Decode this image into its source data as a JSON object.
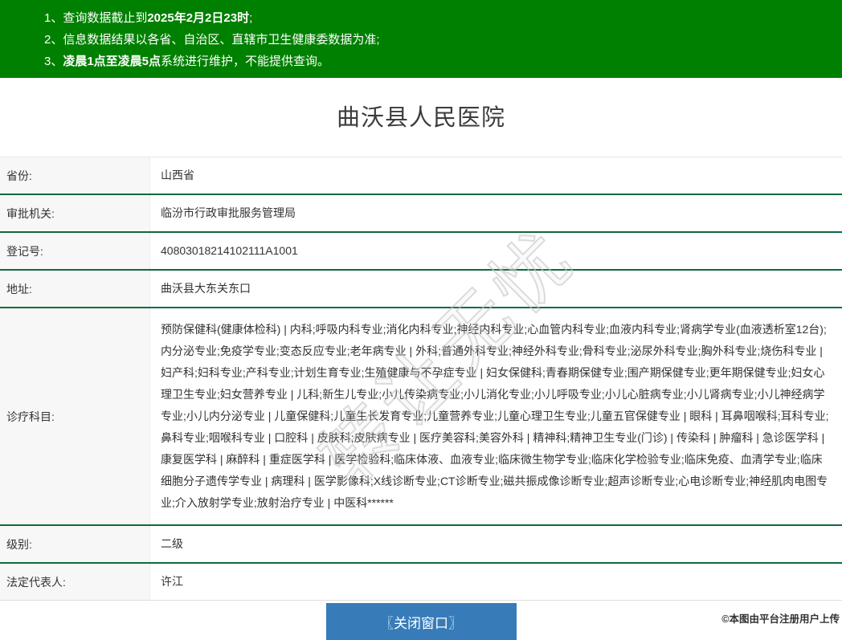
{
  "notice_bar": {
    "items": [
      {
        "prefix": "1、查询数据截止到",
        "bold": "2025年2月2日23时",
        "suffix": ";"
      },
      {
        "prefix": "2、信息数据结果以各省、自治区、直辖市卫生健康委数据为准;",
        "bold": "",
        "suffix": ""
      },
      {
        "prefix": "3、",
        "bold": "凌晨1点至凌晨5点",
        "suffix": "系统进行维护，不能提供查询。"
      }
    ]
  },
  "page": {
    "title": "曲沃县人民医院"
  },
  "details": {
    "rows": [
      {
        "label": "省份:",
        "value": "山西省"
      },
      {
        "label": "审批机关:",
        "value": "临汾市行政审批服务管理局"
      },
      {
        "label": "登记号:",
        "value": "40803018214102111A1001"
      },
      {
        "label": "地址:",
        "value": "曲沃县大东关东口"
      },
      {
        "label": "诊疗科目:",
        "value": "预防保健科(健康体检科) | 内科;呼吸内科专业;消化内科专业;神经内科专业;心血管内科专业;血液内科专业;肾病学专业(血液透析室12台);内分泌专业;免疫学专业;变态反应专业;老年病专业 | 外科;普通外科专业;神经外科专业;骨科专业;泌尿外科专业;胸外科专业;烧伤科专业 | 妇产科;妇科专业;产科专业;计划生育专业;生殖健康与不孕症专业 | 妇女保健科;青春期保健专业;围产期保健专业;更年期保健专业;妇女心理卫生专业;妇女营养专业 | 儿科;新生儿专业;小儿传染病专业;小儿消化专业;小儿呼吸专业;小儿心脏病专业;小儿肾病专业;小儿神经病学专业;小儿内分泌专业 | 儿童保健科;儿童生长发育专业;儿童营养专业;儿童心理卫生专业;儿童五官保健专业 | 眼科 | 耳鼻咽喉科;耳科专业;鼻科专业;咽喉科专业 | 口腔科 | 皮肤科;皮肤病专业 | 医疗美容科;美容外科 | 精神科;精神卫生专业(门诊) | 传染科 | 肿瘤科 | 急诊医学科 | 康复医学科 | 麻醉科 | 重症医学科 | 医学检验科;临床体液、血液专业;临床微生物学专业;临床化学检验专业;临床免疫、血清学专业;临床细胞分子遗传学专业 | 病理科 | 医学影像科;X线诊断专业;CT诊断专业;磁共振成像诊断专业;超声诊断专业;心电诊断专业;神经肌肉电图专业;介入放射学专业;放射治疗专业 | 中医科******"
      },
      {
        "label": "级别:",
        "value": "二级"
      },
      {
        "label": "法定代表人:",
        "value": "许江"
      }
    ]
  },
  "watermark": {
    "text": "转让无忧"
  },
  "footer": {
    "close_button_label": "〖关闭窗口〗",
    "upload_note": "©本图由平台注册用户上传"
  },
  "colors": {
    "notice_bar_green": "#008000",
    "row_divider_green": "#0c6b3c",
    "button_blue": "#377cb8",
    "label_column_bg": "#f7f7f7"
  }
}
